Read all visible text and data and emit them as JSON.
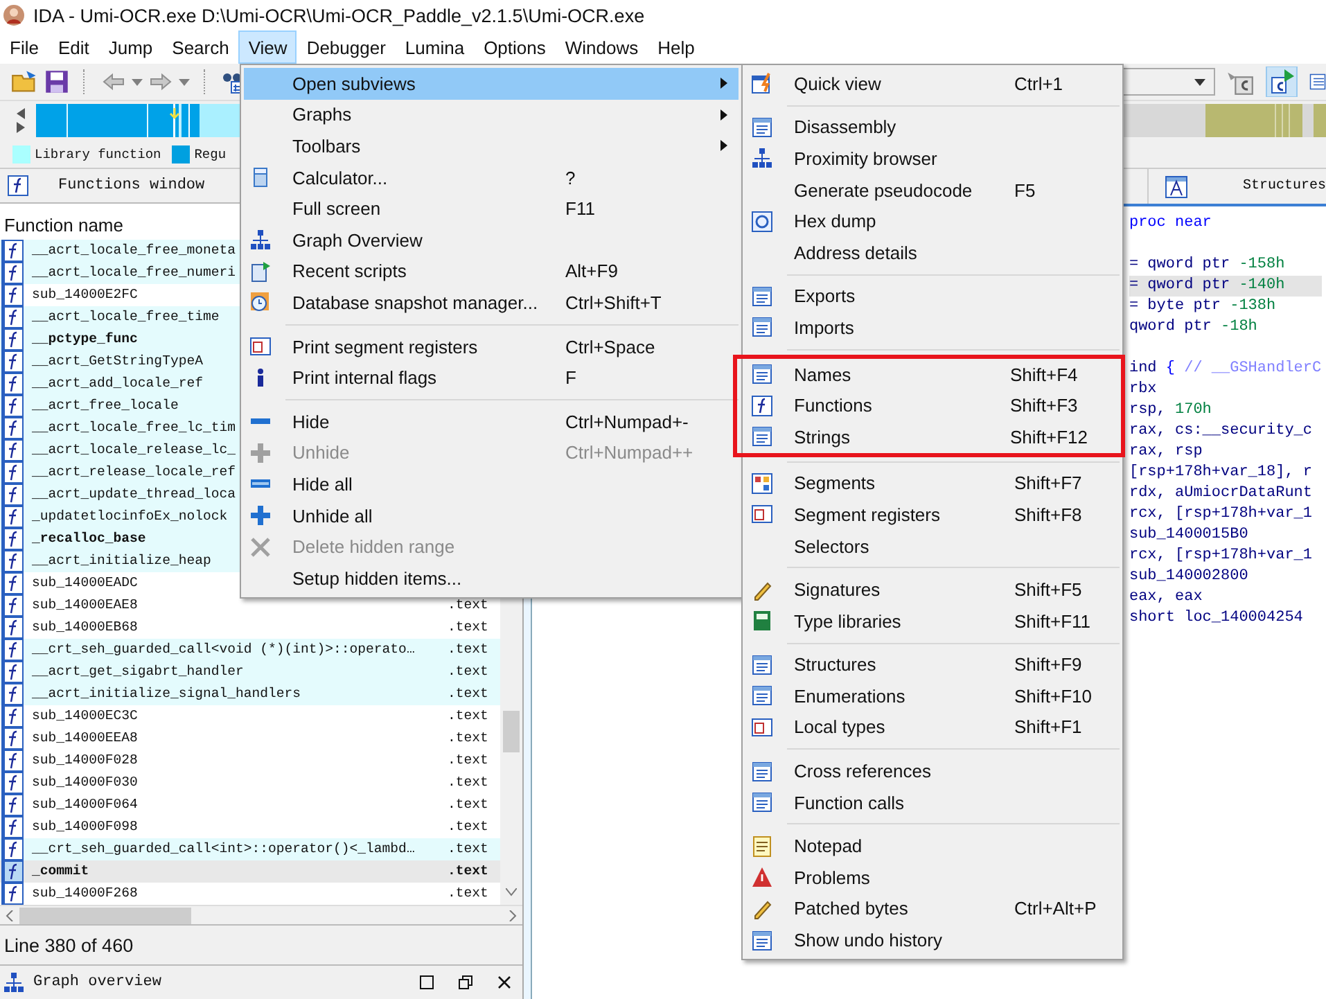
{
  "window": {
    "title": "IDA - Umi-OCR.exe D:\\Umi-OCR\\Umi-OCR_Paddle_v2.1.5\\Umi-OCR.exe"
  },
  "menu_bar": [
    {
      "label": "File",
      "selected": false
    },
    {
      "label": "Edit",
      "selected": false
    },
    {
      "label": "Jump",
      "selected": false
    },
    {
      "label": "Search",
      "selected": false
    },
    {
      "label": "View",
      "selected": true
    },
    {
      "label": "Debugger",
      "selected": false
    },
    {
      "label": "Lumina",
      "selected": false
    },
    {
      "label": "Options",
      "selected": false
    },
    {
      "label": "Windows",
      "selected": false
    },
    {
      "label": "Help",
      "selected": false
    }
  ],
  "legend": [
    {
      "label": "Library function",
      "color": "#aaffff"
    },
    {
      "label": "Regu",
      "color": "#00a0e0"
    }
  ],
  "functions_window": {
    "title": "Functions window",
    "column": "Function name",
    "rows": [
      {
        "name": "__acrt_locale_free_moneta",
        "library": true,
        "bold": false,
        "selected": false
      },
      {
        "name": "__acrt_locale_free_numeri",
        "library": true,
        "bold": false,
        "selected": false
      },
      {
        "name": "sub_14000E2FC",
        "library": false,
        "bold": false,
        "selected": false
      },
      {
        "name": "__acrt_locale_free_time",
        "library": true,
        "bold": false,
        "selected": false
      },
      {
        "name": "__pctype_func",
        "library": true,
        "bold": true,
        "selected": false
      },
      {
        "name": "__acrt_GetStringTypeA",
        "library": true,
        "bold": false,
        "selected": false
      },
      {
        "name": "__acrt_add_locale_ref",
        "library": true,
        "bold": false,
        "selected": false
      },
      {
        "name": "__acrt_free_locale",
        "library": true,
        "bold": false,
        "selected": false
      },
      {
        "name": "__acrt_locale_free_lc_tim",
        "library": true,
        "bold": false,
        "selected": false
      },
      {
        "name": "__acrt_locale_release_lc_",
        "library": true,
        "bold": false,
        "selected": false
      },
      {
        "name": "__acrt_release_locale_ref",
        "library": true,
        "bold": false,
        "selected": false
      },
      {
        "name": "__acrt_update_thread_loca",
        "library": true,
        "bold": false,
        "selected": false
      },
      {
        "name": "_updatetlocinfoEx_nolock",
        "library": true,
        "bold": false,
        "selected": false
      },
      {
        "name": "_recalloc_base",
        "library": true,
        "bold": true,
        "selected": false
      },
      {
        "name": "__acrt_initialize_heap",
        "library": true,
        "bold": false,
        "selected": false
      },
      {
        "name": "sub_14000EADC",
        "library": false,
        "bold": false,
        "selected": false
      },
      {
        "name": "sub_14000EAE8",
        "segment": ".text",
        "library": false,
        "bold": false,
        "selected": false
      },
      {
        "name": "sub_14000EB68",
        "segment": ".text",
        "library": false,
        "bold": false,
        "selected": false
      },
      {
        "name": "__crt_seh_guarded_call<void (*)(int)>::operato…",
        "segment": ".text",
        "library": true,
        "bold": false,
        "selected": false
      },
      {
        "name": "__acrt_get_sigabrt_handler",
        "segment": ".text",
        "library": true,
        "bold": false,
        "selected": false
      },
      {
        "name": "__acrt_initialize_signal_handlers",
        "segment": ".text",
        "library": true,
        "bold": false,
        "selected": false
      },
      {
        "name": "sub_14000EC3C",
        "segment": ".text",
        "library": false,
        "bold": false,
        "selected": false
      },
      {
        "name": "sub_14000EEA8",
        "segment": ".text",
        "library": false,
        "bold": false,
        "selected": false
      },
      {
        "name": "sub_14000F028",
        "segment": ".text",
        "library": false,
        "bold": false,
        "selected": false
      },
      {
        "name": "sub_14000F030",
        "segment": ".text",
        "library": false,
        "bold": false,
        "selected": false
      },
      {
        "name": "sub_14000F064",
        "segment": ".text",
        "library": false,
        "bold": false,
        "selected": false
      },
      {
        "name": "sub_14000F098",
        "segment": ".text",
        "library": false,
        "bold": false,
        "selected": false
      },
      {
        "name": "__crt_seh_guarded_call<int>::operator()<_lambd…",
        "segment": ".text",
        "library": true,
        "bold": false,
        "selected": false
      },
      {
        "name": "_commit",
        "segment": ".text",
        "library": false,
        "bold": true,
        "selected": true
      },
      {
        "name": "sub_14000F268",
        "segment": ".text",
        "library": false,
        "bold": false,
        "selected": false
      }
    ],
    "status": "Line 380 of 460"
  },
  "graph_overview": {
    "title": "Graph overview"
  },
  "disassembly": {
    "tab": "Structures",
    "groups": [
      {
        "lines": [
          {
            "selected": false,
            "parts": [
              {
                "text": "proc near",
                "kind": "keyword"
              }
            ]
          }
        ]
      },
      {
        "lines": [
          {
            "selected": false,
            "parts": [
              {
                "text": "= qword ptr ",
                "kind": "code"
              },
              {
                "text": "-158h",
                "kind": "number"
              }
            ]
          },
          {
            "selected": true,
            "parts": [
              {
                "text": "= qword ptr ",
                "kind": "code"
              },
              {
                "text": "-140h",
                "kind": "number"
              }
            ]
          },
          {
            "selected": false,
            "parts": [
              {
                "text": "= byte ptr ",
                "kind": "code"
              },
              {
                "text": "-138h",
                "kind": "number"
              }
            ]
          },
          {
            "selected": false,
            "parts": [
              {
                "text": "qword ptr ",
                "kind": "code"
              },
              {
                "text": "-18h",
                "kind": "number"
              }
            ]
          }
        ]
      },
      {
        "lines": [
          {
            "selected": false,
            "parts": [
              {
                "text": "ind ",
                "kind": "code"
              },
              {
                "text": "{ ",
                "kind": "keyword"
              },
              {
                "text": "// __GSHandlerC",
                "kind": "comment"
              }
            ]
          },
          {
            "selected": false,
            "parts": [
              {
                "text": "rbx",
                "kind": "code"
              }
            ]
          },
          {
            "selected": false,
            "parts": [
              {
                "text": "rsp, ",
                "kind": "code"
              },
              {
                "text": "170h",
                "kind": "number"
              }
            ]
          },
          {
            "selected": false,
            "parts": [
              {
                "text": "rax, cs:__security_c",
                "kind": "code"
              }
            ]
          },
          {
            "selected": false,
            "parts": [
              {
                "text": "rax, rsp",
                "kind": "code"
              }
            ]
          },
          {
            "selected": false,
            "parts": [
              {
                "text": "[rsp+178h+var_18], r",
                "kind": "code"
              }
            ]
          },
          {
            "selected": false,
            "parts": [
              {
                "text": "rdx, aUmiocrDataRunt",
                "kind": "code"
              }
            ]
          },
          {
            "selected": false,
            "parts": [
              {
                "text": "rcx, [rsp+178h+var_1",
                "kind": "code"
              }
            ]
          },
          {
            "selected": false,
            "parts": [
              {
                "text": "sub_1400015B0",
                "kind": "code"
              }
            ]
          },
          {
            "selected": false,
            "parts": [
              {
                "text": "rcx, [rsp+178h+var_1",
                "kind": "code"
              }
            ]
          },
          {
            "selected": false,
            "parts": [
              {
                "text": "sub_140002800",
                "kind": "code"
              }
            ]
          },
          {
            "selected": false,
            "parts": [
              {
                "text": "eax, eax",
                "kind": "code"
              }
            ]
          },
          {
            "selected": false,
            "parts": [
              {
                "text": "short loc_140004254",
                "kind": "code"
              }
            ]
          }
        ]
      }
    ]
  },
  "view_menu": [
    {
      "kind": "item",
      "label": "Open subviews",
      "submenu": true,
      "selected": true,
      "disabled": false
    },
    {
      "kind": "item",
      "label": "Graphs",
      "submenu": true,
      "selected": false,
      "disabled": false
    },
    {
      "kind": "item",
      "label": "Toolbars",
      "submenu": true,
      "selected": false,
      "disabled": false
    },
    {
      "kind": "item",
      "label": "Calculator...",
      "shortcut": "?",
      "submenu": false,
      "selected": false,
      "disabled": false
    },
    {
      "kind": "item",
      "label": "Full screen",
      "shortcut": "F11",
      "submenu": false,
      "selected": false,
      "disabled": false
    },
    {
      "kind": "item",
      "label": "Graph Overview",
      "submenu": false,
      "selected": false,
      "disabled": false
    },
    {
      "kind": "item",
      "label": "Recent scripts",
      "shortcut": "Alt+F9",
      "submenu": false,
      "selected": false,
      "disabled": false
    },
    {
      "kind": "item",
      "label": "Database snapshot manager...",
      "shortcut": "Ctrl+Shift+T",
      "submenu": false,
      "selected": false,
      "disabled": false
    },
    {
      "kind": "separator"
    },
    {
      "kind": "item",
      "label": "Print segment registers",
      "shortcut": "Ctrl+Space",
      "submenu": false,
      "selected": false,
      "disabled": false
    },
    {
      "kind": "item",
      "label": "Print internal flags",
      "shortcut": "F",
      "submenu": false,
      "selected": false,
      "disabled": false
    },
    {
      "kind": "separator"
    },
    {
      "kind": "item",
      "label": "Hide",
      "shortcut": "Ctrl+Numpad+-",
      "submenu": false,
      "selected": false,
      "disabled": false
    },
    {
      "kind": "item",
      "label": "Unhide",
      "shortcut": "Ctrl+Numpad++",
      "submenu": false,
      "selected": false,
      "disabled": true
    },
    {
      "kind": "item",
      "label": "Hide all",
      "submenu": false,
      "selected": false,
      "disabled": false
    },
    {
      "kind": "item",
      "label": "Unhide all",
      "submenu": false,
      "selected": false,
      "disabled": false
    },
    {
      "kind": "item",
      "label": "Delete hidden range",
      "submenu": false,
      "selected": false,
      "disabled": true
    },
    {
      "kind": "item",
      "label": "Setup hidden items...",
      "submenu": false,
      "selected": false,
      "disabled": false
    }
  ],
  "subviews_menu": [
    {
      "kind": "item",
      "label": "Quick view",
      "shortcut": "Ctrl+1",
      "highlighted": false
    },
    {
      "kind": "separator"
    },
    {
      "kind": "item",
      "label": "Disassembly",
      "highlighted": false
    },
    {
      "kind": "item",
      "label": "Proximity browser",
      "highlighted": false
    },
    {
      "kind": "item",
      "label": "Generate pseudocode",
      "shortcut": "F5",
      "highlighted": false
    },
    {
      "kind": "item",
      "label": "Hex dump",
      "highlighted": false
    },
    {
      "kind": "item",
      "label": "Address details",
      "highlighted": false
    },
    {
      "kind": "separator"
    },
    {
      "kind": "item",
      "label": "Exports",
      "highlighted": false
    },
    {
      "kind": "item",
      "label": "Imports",
      "highlighted": false
    },
    {
      "kind": "separator"
    },
    {
      "kind": "item",
      "label": "Names",
      "shortcut": "Shift+F4",
      "highlighted": true
    },
    {
      "kind": "item",
      "label": "Functions",
      "shortcut": "Shift+F3",
      "highlighted": true
    },
    {
      "kind": "item",
      "label": "Strings",
      "shortcut": "Shift+F12",
      "highlighted": true
    },
    {
      "kind": "separator"
    },
    {
      "kind": "item",
      "label": "Segments",
      "shortcut": "Shift+F7",
      "highlighted": false
    },
    {
      "kind": "item",
      "label": "Segment registers",
      "shortcut": "Shift+F8",
      "highlighted": false
    },
    {
      "kind": "item",
      "label": "Selectors",
      "highlighted": false
    },
    {
      "kind": "separator"
    },
    {
      "kind": "item",
      "label": "Signatures",
      "shortcut": "Shift+F5",
      "highlighted": false
    },
    {
      "kind": "item",
      "label": "Type libraries",
      "shortcut": "Shift+F11",
      "highlighted": false
    },
    {
      "kind": "separator"
    },
    {
      "kind": "item",
      "label": "Structures",
      "shortcut": "Shift+F9",
      "highlighted": false
    },
    {
      "kind": "item",
      "label": "Enumerations",
      "shortcut": "Shift+F10",
      "highlighted": false
    },
    {
      "kind": "item",
      "label": "Local types",
      "shortcut": "Shift+F1",
      "highlighted": false
    },
    {
      "kind": "separator"
    },
    {
      "kind": "item",
      "label": "Cross references",
      "highlighted": false
    },
    {
      "kind": "item",
      "label": "Function calls",
      "highlighted": false
    },
    {
      "kind": "separator"
    },
    {
      "kind": "item",
      "label": "Notepad",
      "highlighted": false
    },
    {
      "kind": "item",
      "label": "Problems",
      "highlighted": false
    },
    {
      "kind": "item",
      "label": "Patched bytes",
      "shortcut": "Ctrl+Alt+P",
      "highlighted": false
    },
    {
      "kind": "item",
      "label": "Show undo history",
      "highlighted": false
    }
  ]
}
